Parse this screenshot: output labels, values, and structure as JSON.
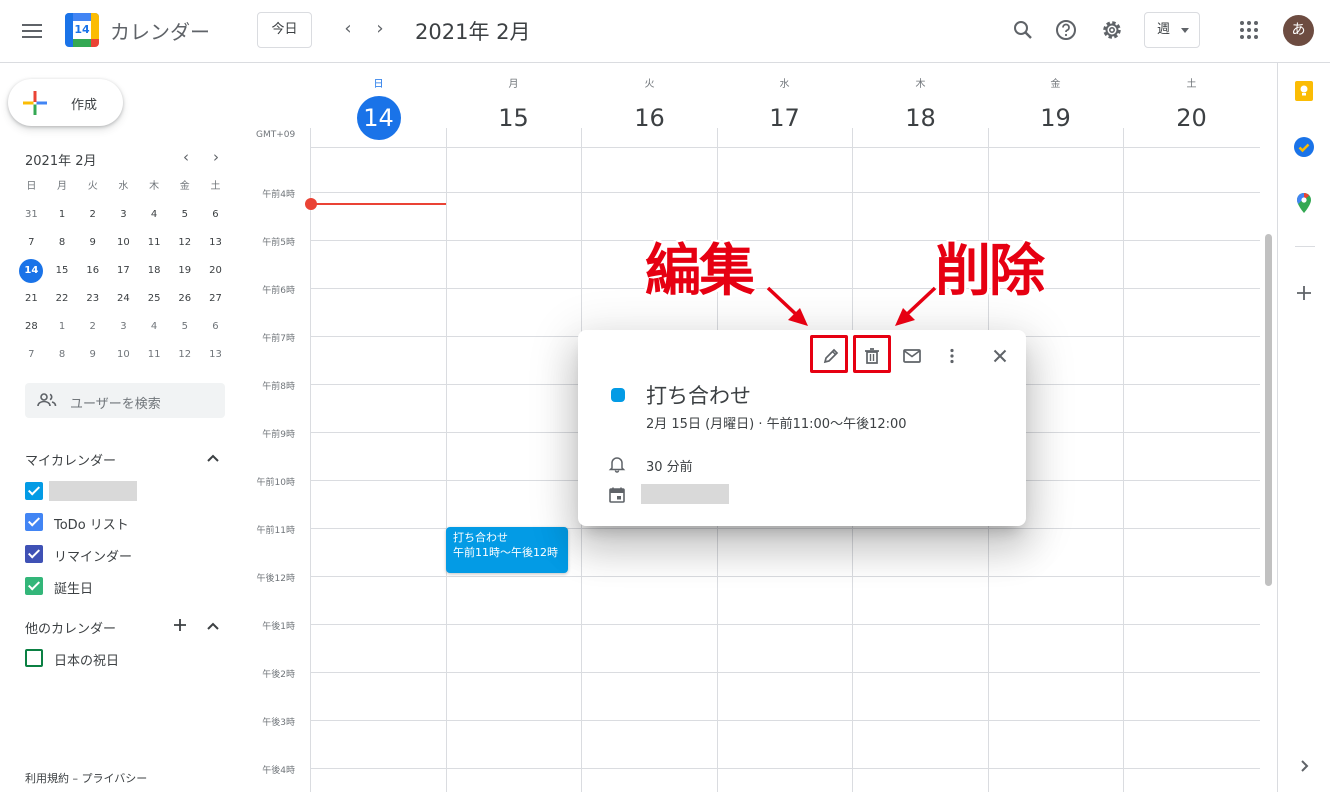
{
  "header": {
    "app_title": "カレンダー",
    "logo_day": "14",
    "today_label": "今日",
    "date_title": "2021年 2月",
    "view_label": "週",
    "avatar_letter": "あ"
  },
  "sidebar": {
    "create_label": "作成",
    "mini_calendar": {
      "title": "2021年 2月",
      "weekdays": [
        "日",
        "月",
        "火",
        "水",
        "木",
        "金",
        "土"
      ],
      "weeks": [
        [
          "31",
          "1",
          "2",
          "3",
          "4",
          "5",
          "6"
        ],
        [
          "7",
          "8",
          "9",
          "10",
          "11",
          "12",
          "13"
        ],
        [
          "14",
          "15",
          "16",
          "17",
          "18",
          "19",
          "20"
        ],
        [
          "21",
          "22",
          "23",
          "24",
          "25",
          "26",
          "27"
        ],
        [
          "28",
          "1",
          "2",
          "3",
          "4",
          "5",
          "6"
        ],
        [
          "7",
          "8",
          "9",
          "10",
          "11",
          "12",
          "13"
        ]
      ]
    },
    "search_placeholder": "ユーザーを検索",
    "my_calendars_title": "マイカレンダー",
    "my_calendars": [
      {
        "label": "",
        "color": "#039be5"
      },
      {
        "label": "ToDo リスト",
        "color": "#4285f4"
      },
      {
        "label": "リマインダー",
        "color": "#3f51b5"
      },
      {
        "label": "誕生日",
        "color": "#33b679"
      }
    ],
    "other_calendars_title": "他のカレンダー",
    "other_calendars": [
      {
        "label": "日本の祝日",
        "color": "#0b8043"
      }
    ],
    "footer": "利用規約 – プライバシー"
  },
  "week": {
    "timezone": "GMT+09",
    "days": [
      {
        "dow": "日",
        "num": "14"
      },
      {
        "dow": "月",
        "num": "15"
      },
      {
        "dow": "火",
        "num": "16"
      },
      {
        "dow": "水",
        "num": "17"
      },
      {
        "dow": "木",
        "num": "18"
      },
      {
        "dow": "金",
        "num": "19"
      },
      {
        "dow": "土",
        "num": "20"
      }
    ],
    "hours": [
      "午前4時",
      "午前5時",
      "午前6時",
      "午前7時",
      "午前8時",
      "午前9時",
      "午前10時",
      "午前11時",
      "午後12時",
      "午後1時",
      "午後2時",
      "午後3時",
      "午後4時"
    ]
  },
  "event_chip": {
    "title": "打ち合わせ",
    "time": "午前11時～午後12時"
  },
  "popup": {
    "title": "打ち合わせ",
    "time": "2月 15日 (月曜日)  ·  午前11:00～午後12:00",
    "reminder": "30 分前",
    "color": "#039be5"
  },
  "annotations": {
    "edit": "編集",
    "delete": "削除",
    "color": "#e60012"
  }
}
